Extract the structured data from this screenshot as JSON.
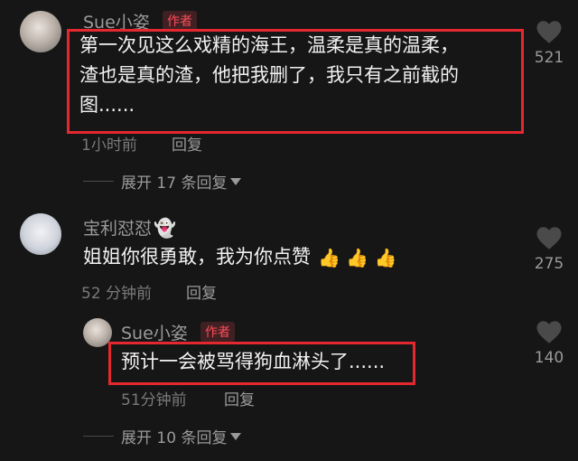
{
  "comments": [
    {
      "username": "Sue小姿",
      "badge": "作者",
      "text_line1": "第一次见这么戏精的海王，温柔是真的温柔，",
      "text_line2": "渣也是真的渣，他把我删了，我只有之前截的",
      "text_line3": "图......",
      "time": "1小时前",
      "reply": "回复",
      "likes": "521",
      "expand": "展开 17 条回复",
      "like_icon": "heart-icon"
    },
    {
      "username": "宝利怼怼",
      "username_emoji": "👻",
      "text": "姐姐你很勇敢，我为你点赞",
      "text_emoji": "👍 👍 👍",
      "time": "52 分钟前",
      "reply": "回复",
      "likes": "275",
      "like_icon": "heart-icon"
    },
    {
      "username": "Sue小姿",
      "badge": "作者",
      "text": "预计一会被骂得狗血淋头了......",
      "time": "51分钟前",
      "reply": "回复",
      "likes": "140",
      "expand": "展开 10 条回复",
      "like_icon": "heart-icon"
    }
  ],
  "colors": {
    "background": "#161616",
    "author_badge": "#ff4d5b",
    "highlight_box": "#e5282f"
  }
}
